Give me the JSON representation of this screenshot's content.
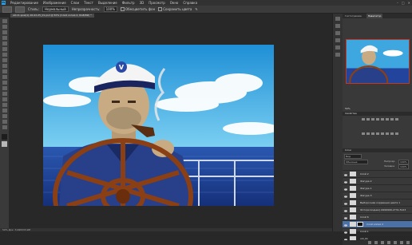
{
  "menu": {
    "items": [
      "Редактирование",
      "Изображение",
      "Слои",
      "Текст",
      "Выделение",
      "Фильтр",
      "3D",
      "Просмотр",
      "Окно",
      "Справка"
    ]
  },
  "options": {
    "style_label": "Стиль:",
    "style_value": "Нормальный",
    "opacity_label": "Непрозрачность:",
    "opacity_value": "100%",
    "check1_label": "Обесцветить фон",
    "check2_label": "Сохранить цвета"
  },
  "document": {
    "tab_title": "ий-11-дом(1)-16-02-25_01.psd @ 50% (Слой копия 2, RGB/8#) *"
  },
  "status": {
    "text": "50% Док: 3,99M/33,9M"
  },
  "panel": {
    "tab_histogram": "Гистограмма",
    "tab_navigator": "Навигатор",
    "zoom_value": "50%",
    "properties_title": "Свойства",
    "layers_title": "Слои",
    "kind_label": "Вид",
    "blend_mode": "Обычные",
    "opacity_label": "Непрозр.",
    "opacity_value": "100%",
    "fill_label": "Заливка",
    "fill_value": "100%"
  },
  "layers": [
    {
      "name": "Слой 2"
    },
    {
      "name": "Фигура 2"
    },
    {
      "name": "Фигура 1"
    },
    {
      "name": "Фигура 3"
    },
    {
      "name": "Выборочная коррекция цвета 1"
    },
    {
      "name": "Фото(исходник)-9999999-2731-5123"
    },
    {
      "name": "Слой 6"
    },
    {
      "name": "Слой копия 2",
      "selected": true
    },
    {
      "name": "Слой 1"
    },
    {
      "name": "old_01"
    }
  ],
  "colors": {
    "accent_selected": "#4b72a8",
    "sky": "#2fa0dc",
    "sea": "#1f3f92",
    "wheel": "#8a3f14"
  }
}
